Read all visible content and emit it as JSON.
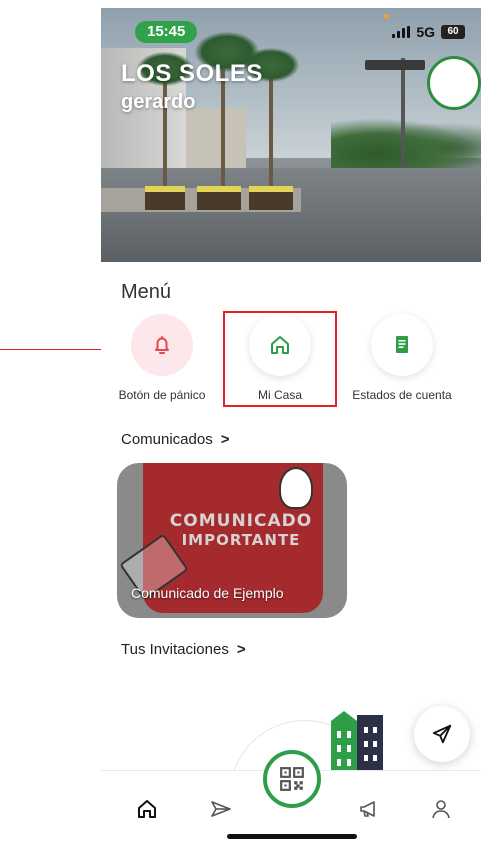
{
  "status_bar": {
    "time": "15:45",
    "network": "5G",
    "battery": "60"
  },
  "header": {
    "title": "LOS SOLES",
    "user": "gerardo"
  },
  "menu": {
    "title": "Menú",
    "items": [
      {
        "label": "Botón de pánico",
        "icon": "bell-icon"
      },
      {
        "label": "Mi Casa",
        "icon": "home-icon"
      },
      {
        "label": "Estados de cuenta",
        "icon": "receipt-icon"
      }
    ]
  },
  "comunicados": {
    "label": "Comunicados",
    "card": {
      "line1": "COMUNICADO",
      "line2": "IMPORTANTE",
      "caption": "Comunicado de Ejemplo"
    }
  },
  "invitaciones": {
    "label": "Tus Invitaciones"
  },
  "tabbar": {
    "items": [
      "home-icon",
      "send-icon",
      "qr-code-icon",
      "megaphone-icon",
      "user-icon"
    ]
  },
  "colors": {
    "accent_green": "#2e9e49",
    "annotation_red": "#e02424",
    "card_red": "#a52a2e"
  }
}
